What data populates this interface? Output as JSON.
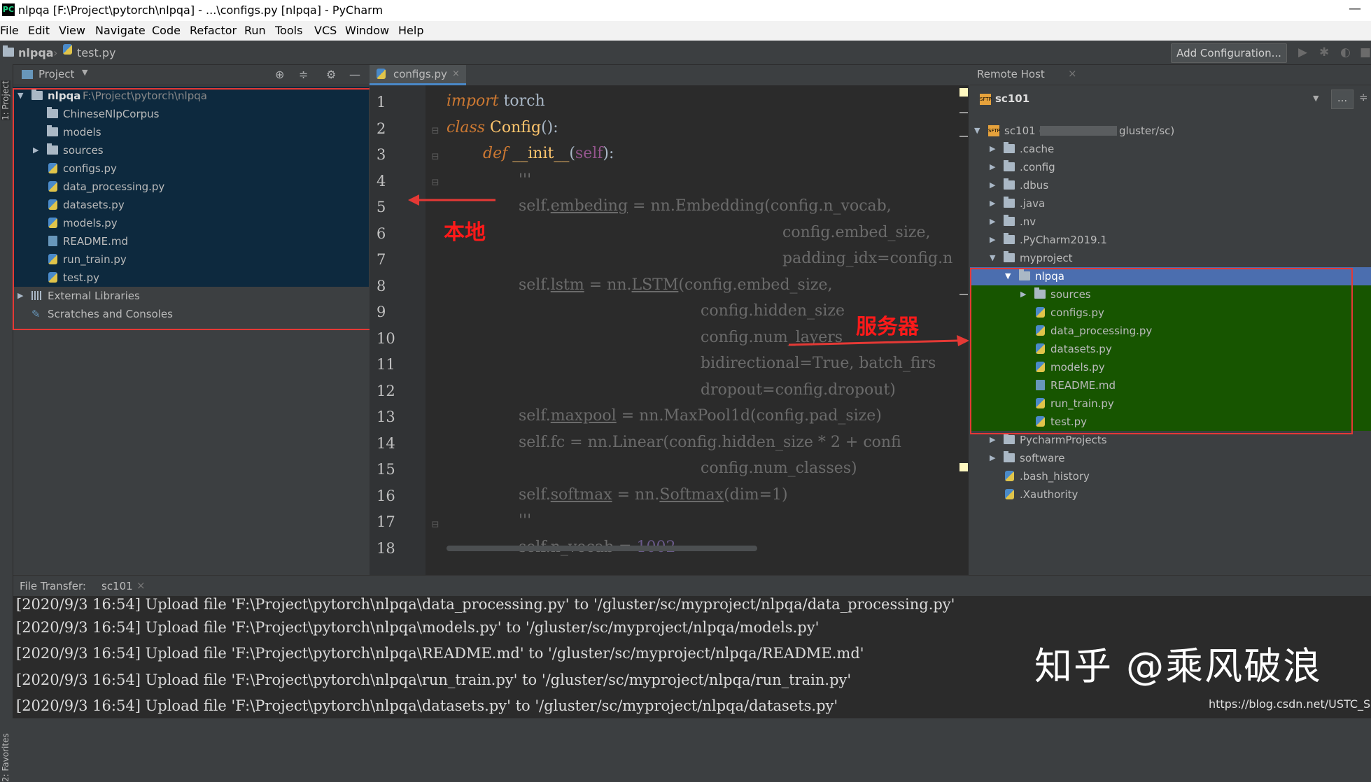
{
  "window": {
    "title": "nlpqa [F:\\Project\\pytorch\\nlpqa] - ...\\configs.py [nlpqa] - PyCharm",
    "app_icon": "PC",
    "minimize": "—"
  },
  "menu": [
    "File",
    "Edit",
    "View",
    "Navigate",
    "Code",
    "Refactor",
    "Run",
    "Tools",
    "VCS",
    "Window",
    "Help"
  ],
  "navbar": {
    "project": "nlpqa",
    "file": "test.py",
    "add_configuration": "Add Configuration..."
  },
  "left_stripe": {
    "project_tab": "1: Project",
    "favorites_tab": "2: Favorites"
  },
  "project_panel": {
    "header": "Project",
    "root": {
      "name": "nlpqa",
      "path": "F:\\Project\\pytorch\\nlpqa"
    },
    "items": [
      {
        "label": "ChineseNlpCorpus",
        "kind": "folder"
      },
      {
        "label": "models",
        "kind": "folder"
      },
      {
        "label": "sources",
        "kind": "folder"
      },
      {
        "label": "configs.py",
        "kind": "py"
      },
      {
        "label": "data_processing.py",
        "kind": "py"
      },
      {
        "label": "datasets.py",
        "kind": "py"
      },
      {
        "label": "models.py",
        "kind": "py"
      },
      {
        "label": "README.md",
        "kind": "md"
      },
      {
        "label": "run_train.py",
        "kind": "py"
      },
      {
        "label": "test.py",
        "kind": "py"
      }
    ],
    "external_libraries": "External Libraries",
    "scratches": "Scratches and Consoles"
  },
  "editor": {
    "tab": "configs.py",
    "line_numbers": [
      "1",
      "2",
      "3",
      "4",
      "5",
      "6",
      "7",
      "8",
      "9",
      "10",
      "11",
      "12",
      "13",
      "14",
      "15",
      "16",
      "17",
      "18"
    ],
    "lines": {
      "l1_kw": "import",
      "l1_rest": " torch",
      "l2_kw": "class",
      "l2_name": " Config",
      "l2_rest": "():",
      "l3_kw": "def",
      "l3_name": " __init__",
      "l3_p": "(",
      "l3_self": "self",
      "l3_end": "):",
      "l4": "'''",
      "l5a": "self.",
      "l5b": "embeding",
      "l5c": " = nn.Embedding(config.n_vocab,",
      "l6": "config.embed_size,",
      "l7": "padding_idx=config.n",
      "l8a": "self.",
      "l8b": "lstm",
      "l8c": " = nn.",
      "l8d": "LSTM",
      "l8e": "(config.embed_size,",
      "l9": "config.hidden_size",
      "l10": "config.num_layers",
      "l11": "bidirectional=True, batch_firs",
      "l12": "dropout=config.dropout)",
      "l13a": "self.",
      "l13b": "maxpool",
      "l13c": " = nn.MaxPool1d(config.pad_size)",
      "l14": "self.fc = nn.Linear(config.hidden_size * 2 + confi",
      "l15": "config.num_classes)",
      "l16a": "self.",
      "l16b": "softmax",
      "l16c": " = nn.",
      "l16d": "Softmax",
      "l16e": "(dim=1)",
      "l17": "'''",
      "l18a": "self.n_vocab = ",
      "l18b": "1002"
    },
    "annotation_local": "本地",
    "annotation_server": "服务器"
  },
  "remote_host": {
    "header": "Remote Host",
    "server": "sc101",
    "more_button": "...",
    "root": "sc101 (",
    "root_suffix": "gluster/sc)",
    "items": [
      {
        "label": ".cache",
        "kind": "folder"
      },
      {
        "label": ".config",
        "kind": "folder"
      },
      {
        "label": ".dbus",
        "kind": "folder"
      },
      {
        "label": ".java",
        "kind": "folder"
      },
      {
        "label": ".nv",
        "kind": "folder"
      },
      {
        "label": ".PyCharm2019.1",
        "kind": "folder"
      },
      {
        "label": "myproject",
        "kind": "folder"
      }
    ],
    "nlpqa": "nlpqa",
    "nlpqa_items": [
      {
        "label": "sources",
        "kind": "folder"
      },
      {
        "label": "configs.py",
        "kind": "py"
      },
      {
        "label": "data_processing.py",
        "kind": "py"
      },
      {
        "label": "datasets.py",
        "kind": "py"
      },
      {
        "label": "models.py",
        "kind": "py"
      },
      {
        "label": "README.md",
        "kind": "md"
      },
      {
        "label": "run_train.py",
        "kind": "py"
      },
      {
        "label": "test.py",
        "kind": "py"
      }
    ],
    "after_items": [
      {
        "label": "PycharmProjects",
        "kind": "folder"
      },
      {
        "label": "software",
        "kind": "folder"
      },
      {
        "label": ".bash_history",
        "kind": "file"
      },
      {
        "label": ".Xauthority",
        "kind": "file"
      }
    ]
  },
  "bottom": {
    "label": "File Transfer:",
    "tab": "sc101",
    "log": [
      "[2020/9/3 16:54] Upload file 'F:\\Project\\pytorch\\nlpqa\\data_processing.py' to '/gluster/sc/myproject/nlpqa/data_processing.py'",
      "[2020/9/3 16:54] Upload file 'F:\\Project\\pytorch\\nlpqa\\models.py' to '/gluster/sc/myproject/nlpqa/models.py'",
      "[2020/9/3 16:54] Upload file 'F:\\Project\\pytorch\\nlpqa\\README.md' to '/gluster/sc/myproject/nlpqa/README.md'",
      "[2020/9/3 16:54] Upload file 'F:\\Project\\pytorch\\nlpqa\\run_train.py' to '/gluster/sc/myproject/nlpqa/run_train.py'",
      "[2020/9/3 16:54] Upload file 'F:\\Project\\pytorch\\nlpqa\\datasets.py' to '/gluster/sc/myproject/nlpqa/datasets.py'"
    ],
    "watermark": "知乎 @乘风破浪",
    "blog_url": "https://blog.csdn.net/USTC_SC"
  }
}
